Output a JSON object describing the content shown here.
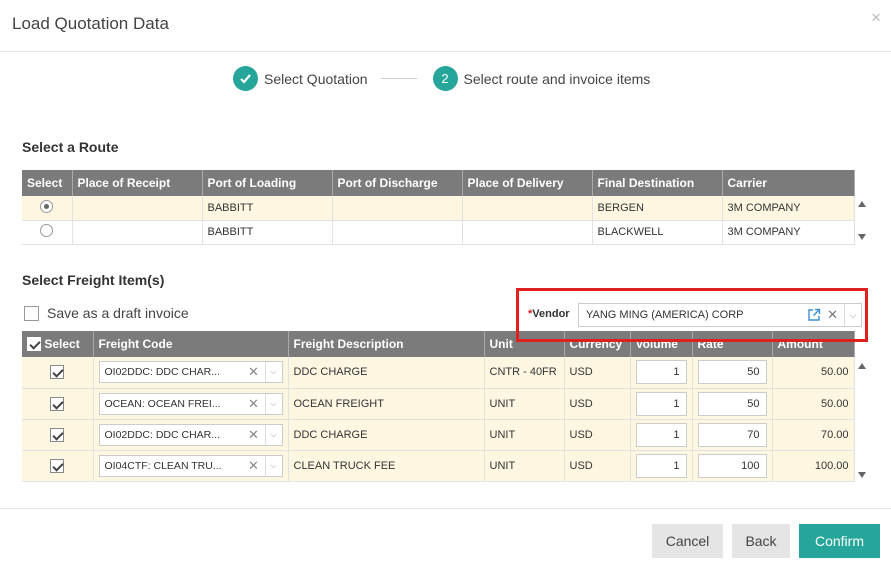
{
  "dialog": {
    "title": "Load Quotation Data",
    "close": "×"
  },
  "stepper": {
    "steps": [
      {
        "label": "Select Quotation",
        "state": "done"
      },
      {
        "number": "2",
        "label": "Select route and invoice items",
        "state": "active"
      }
    ]
  },
  "route": {
    "title": "Select a Route",
    "columns": [
      "Select",
      "Place of Receipt",
      "Port of Loading",
      "Port of Discharge",
      "Place of Delivery",
      "Final Destination",
      "Carrier"
    ],
    "rows": [
      {
        "selected": true,
        "place_of_receipt": "",
        "port_of_loading": "BABBITT",
        "port_of_discharge": "",
        "place_of_delivery": "",
        "final_destination": "BERGEN",
        "carrier": "3M COMPANY"
      },
      {
        "selected": false,
        "place_of_receipt": "",
        "port_of_loading": "BABBITT",
        "port_of_discharge": "",
        "place_of_delivery": "",
        "final_destination": "BLACKWELL",
        "carrier": "3M COMPANY"
      }
    ]
  },
  "freight": {
    "title": "Select Freight Item(s)",
    "draft_label": "Save as a draft invoice",
    "vendor_label": "Vendor",
    "vendor_required": "*",
    "vendor_value": "YANG MING (AMERICA) CORP",
    "columns": [
      "Select",
      "Freight Code",
      "Freight Description",
      "Unit",
      "Currency",
      "Volume",
      "Rate",
      "Amount"
    ],
    "rows": [
      {
        "checked": true,
        "code": "OI02DDC: DDC CHAR...",
        "description": "DDC CHARGE",
        "unit": "CNTR - 40FR",
        "currency": "USD",
        "volume": "1",
        "rate": "50",
        "amount": "50.00"
      },
      {
        "checked": true,
        "code": "OCEAN: OCEAN FREI...",
        "description": "OCEAN FREIGHT",
        "unit": "UNIT",
        "currency": "USD",
        "volume": "1",
        "rate": "50",
        "amount": "50.00"
      },
      {
        "checked": true,
        "code": "OI02DDC: DDC CHAR...",
        "description": "DDC CHARGE",
        "unit": "UNIT",
        "currency": "USD",
        "volume": "1",
        "rate": "70",
        "amount": "70.00"
      },
      {
        "checked": true,
        "code": "OI04CTF: CLEAN TRU...",
        "description": "CLEAN TRUCK FEE",
        "unit": "UNIT",
        "currency": "USD",
        "volume": "1",
        "rate": "100",
        "amount": "100.00"
      }
    ]
  },
  "footer": {
    "cancel": "Cancel",
    "back": "Back",
    "confirm": "Confirm"
  },
  "colors": {
    "accent": "#26a69a",
    "highlight": "#e0201f",
    "header": "#7b7b7b",
    "row_odd": "#fdf7e2"
  }
}
